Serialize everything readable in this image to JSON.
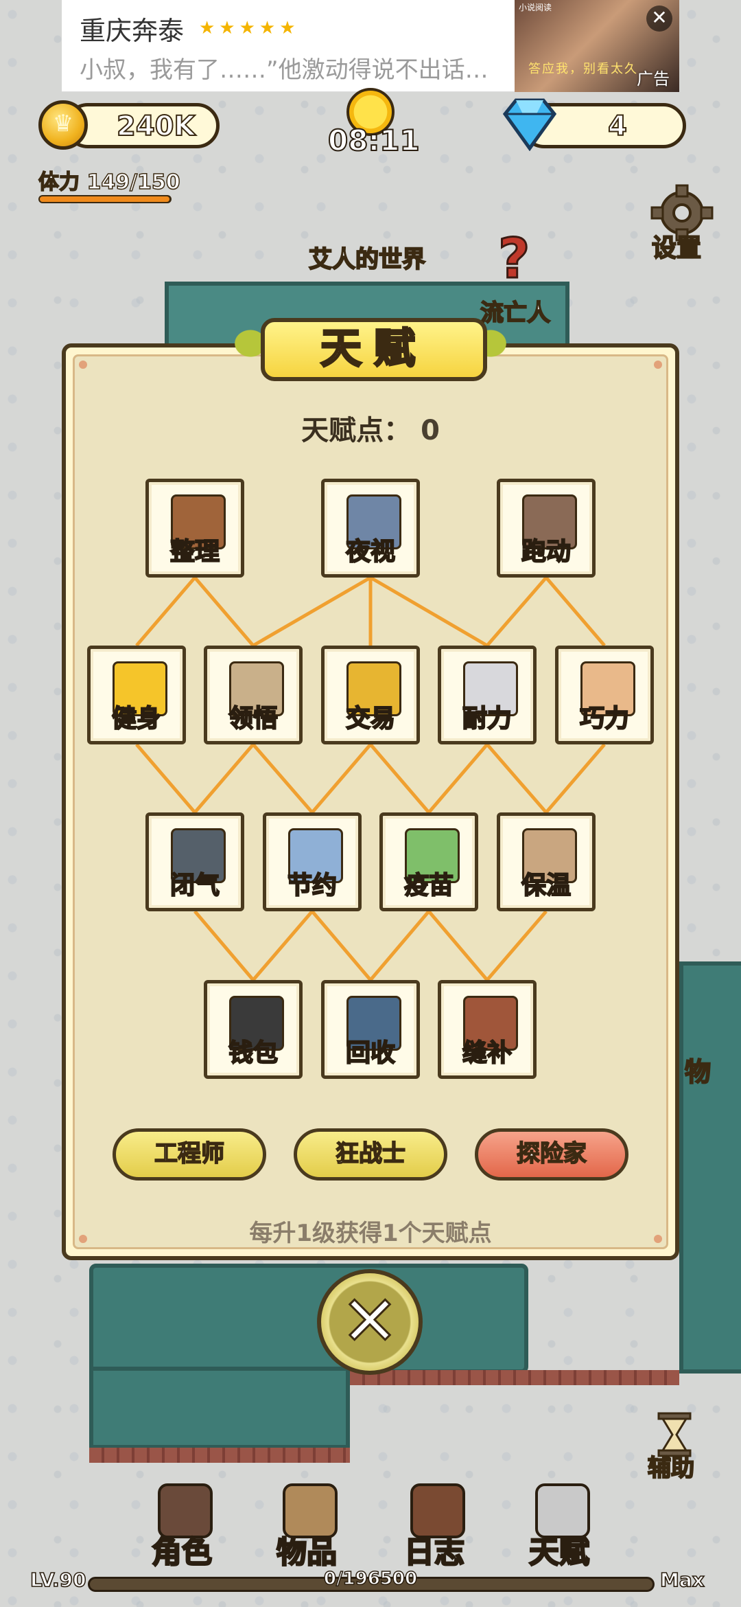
{
  "ad": {
    "title": "重庆奔泰",
    "stars": "★★★★★",
    "description": "小叔，我有了……”他激动得说不出话…",
    "image_top_text": "小说阅读",
    "image_caption": "答应我，别看太久",
    "close_glyph": "✕",
    "label": "广告"
  },
  "hud": {
    "coins": "240K",
    "time": "08:11",
    "gems": "4",
    "stamina_label": "体力 149/150",
    "stamina_fraction": 0.9933,
    "settings_label": "设置"
  },
  "map": {
    "world_label": "艾人的世界",
    "exile_label": "流亡人",
    "question_mark": "?",
    "side_label": "物",
    "assist_label": "辅助"
  },
  "talent": {
    "title": "天赋",
    "points_label": "天赋点：",
    "points_value": "0",
    "nodes": [
      {
        "label": "整理",
        "icon": "crate-icon",
        "color": "#a0643a"
      },
      {
        "label": "夜视",
        "icon": "binoculars-icon",
        "color": "#6f86a6"
      },
      {
        "label": "跑动",
        "icon": "boots-icon",
        "color": "#8a6a56"
      },
      {
        "label": "健身",
        "icon": "lightning-icon",
        "color": "#f5c52a"
      },
      {
        "label": "领悟",
        "icon": "scroll-icon",
        "color": "#c9b08a"
      },
      {
        "label": "交易",
        "icon": "coins-icon",
        "color": "#e7b531"
      },
      {
        "label": "耐力",
        "icon": "medkit-icon",
        "color": "#d8d8dc"
      },
      {
        "label": "巧力",
        "icon": "hand-icon",
        "color": "#e9b98a"
      },
      {
        "label": "闭气",
        "icon": "oxygen-tank-icon",
        "color": "#55606a"
      },
      {
        "label": "节约",
        "icon": "bottle-icon",
        "color": "#8fb0d6"
      },
      {
        "label": "疫苗",
        "icon": "syringe-icon",
        "color": "#7fbf6a"
      },
      {
        "label": "保温",
        "icon": "mitten-icon",
        "color": "#c9a680"
      },
      {
        "label": "钱包",
        "icon": "wallet-icon",
        "color": "#3a3a3a"
      },
      {
        "label": "回收",
        "icon": "recycle-gear-icon",
        "color": "#4a6a8a"
      },
      {
        "label": "缝补",
        "icon": "shield-patch-icon",
        "color": "#a0563a"
      }
    ],
    "classes": [
      {
        "label": "工程师",
        "active": false
      },
      {
        "label": "狂战士",
        "active": false
      },
      {
        "label": "探险家",
        "active": true
      }
    ],
    "footer_note": "每升1级获得1个天赋点",
    "close_glyph": "✕"
  },
  "bottom_nav": {
    "items": [
      {
        "label": "角色",
        "icon": "character-icon",
        "color": "#6a4a3a"
      },
      {
        "label": "物品",
        "icon": "backpack-icon",
        "color": "#b08a5a"
      },
      {
        "label": "日志",
        "icon": "journal-icon",
        "color": "#7a4a32"
      },
      {
        "label": "天赋",
        "icon": "winged-sword-icon",
        "color": "#c9c9c9"
      }
    ],
    "level": "LV.90",
    "xp": "0/196500",
    "xp_fraction": 0,
    "max_label": "Max"
  }
}
